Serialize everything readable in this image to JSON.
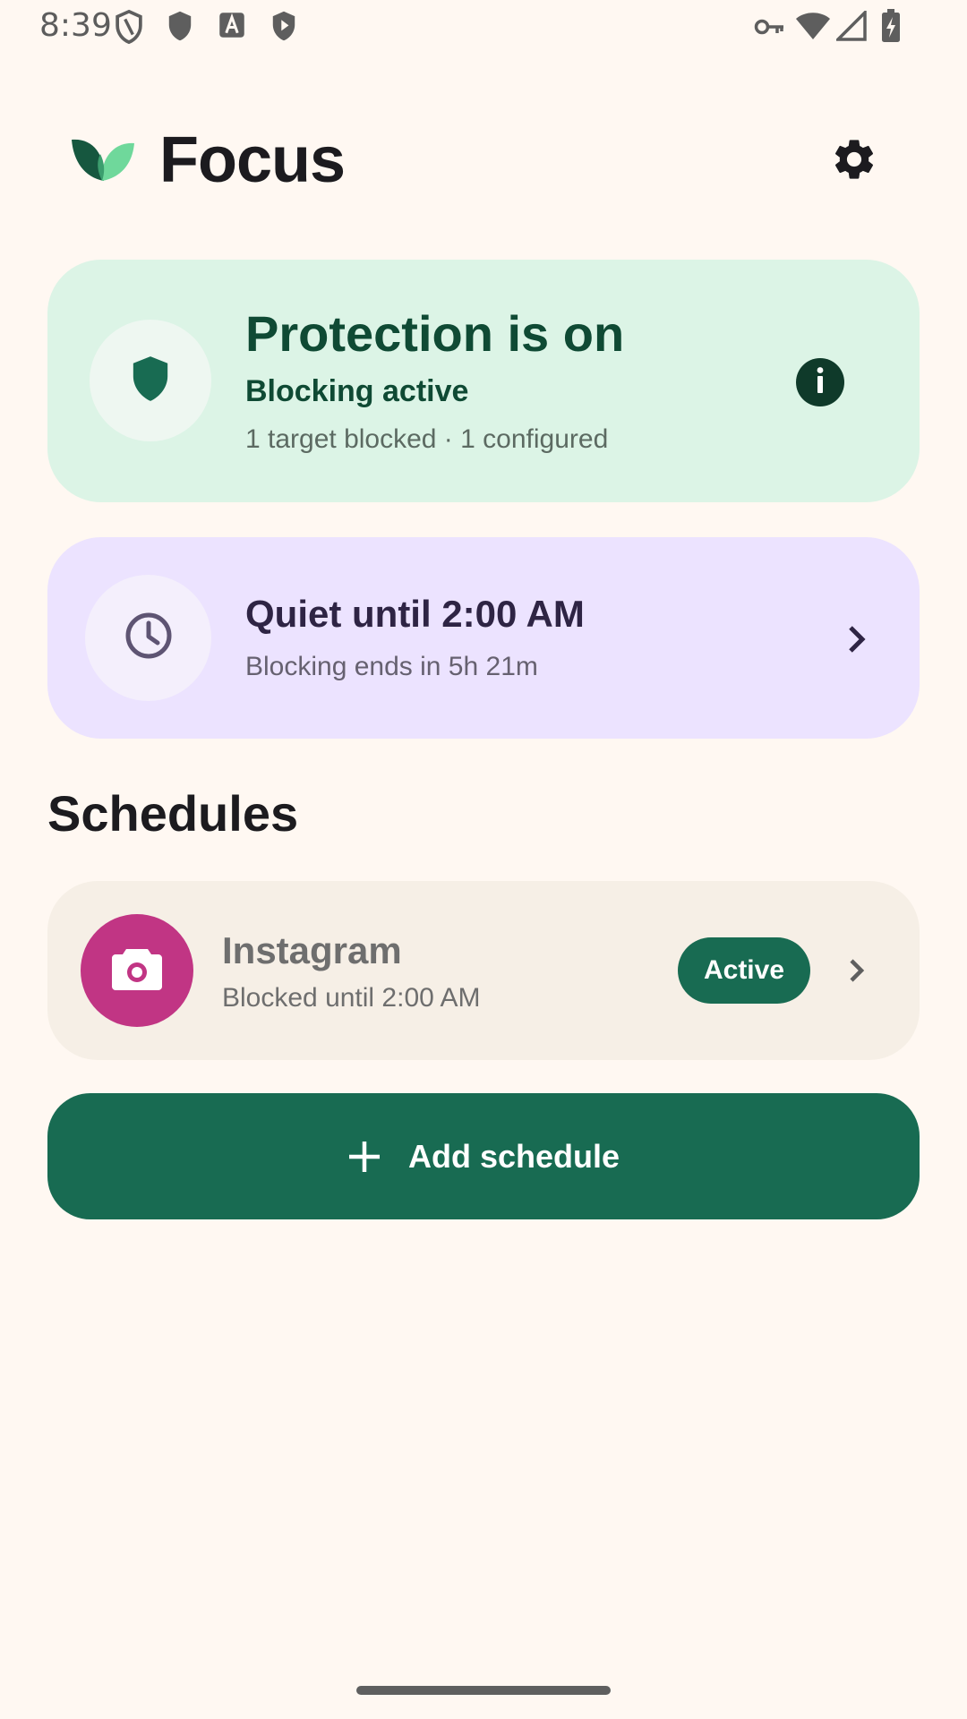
{
  "status_bar": {
    "time": "8:39",
    "icons": [
      "shield-outline-icon",
      "shield-icon",
      "text-a-icon",
      "shield-play-icon",
      "vpn-key-icon",
      "wifi-icon",
      "signal-icon",
      "battery-charging-icon"
    ]
  },
  "header": {
    "title": "Focus",
    "logo_icon": "leaf-logo-icon",
    "settings_icon": "gear-icon"
  },
  "protection_card": {
    "title": "Protection is on",
    "subtitle": "Blocking active",
    "detail": "1 target blocked · 1 configured",
    "icon": "shield-icon",
    "info_icon": "info-icon"
  },
  "quiet_card": {
    "title": "Quiet until 2:00 AM",
    "detail": "Blocking ends in 5h 21m",
    "icon": "clock-icon"
  },
  "schedules": {
    "heading": "Schedules",
    "items": [
      {
        "name": "Instagram",
        "detail": "Blocked until 2:00 AM",
        "status": "Active",
        "icon": "camera-icon"
      }
    ],
    "add_label": "Add schedule"
  },
  "colors": {
    "background": "#FFF8F2",
    "primary": "#186B52",
    "protection_bg": "#DCF4E6",
    "quiet_bg": "#ECE3FF",
    "schedule_bg": "#F6EFE6",
    "instagram": "#C13584"
  }
}
